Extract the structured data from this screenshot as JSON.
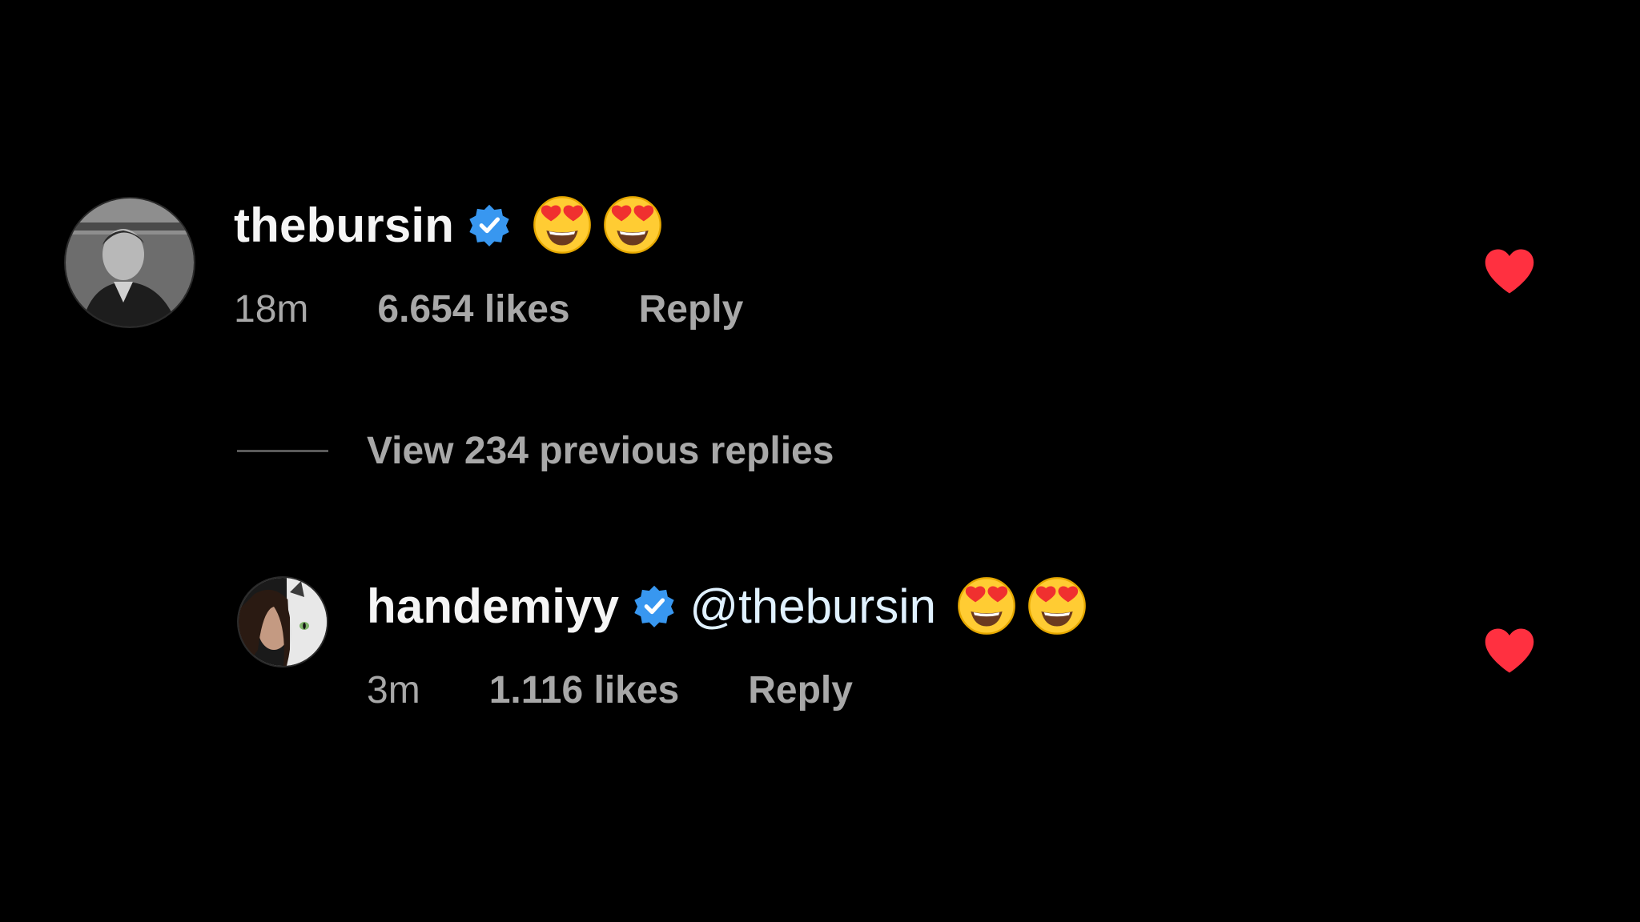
{
  "comments": [
    {
      "username": "thebursin",
      "verified": true,
      "mention": "",
      "emoji_icons": [
        "smiling-face-with-heart-eyes",
        "smiling-face-with-heart-eyes"
      ],
      "time": "18m",
      "likes": "6.654 likes",
      "reply_label": "Reply",
      "liked": true
    },
    {
      "username": "handemiyy",
      "verified": true,
      "mention": "@thebursin",
      "emoji_icons": [
        "smiling-face-with-heart-eyes",
        "smiling-face-with-heart-eyes"
      ],
      "time": "3m",
      "likes": "1.116 likes",
      "reply_label": "Reply",
      "liked": true
    }
  ],
  "replies": {
    "view_label": "View 234 previous replies"
  },
  "colors": {
    "background": "#000000",
    "verified_badge": "#3897f0",
    "heart": "#ff3040",
    "secondary_text": "#a8a8a8",
    "primary_text": "#f5f5f5"
  }
}
